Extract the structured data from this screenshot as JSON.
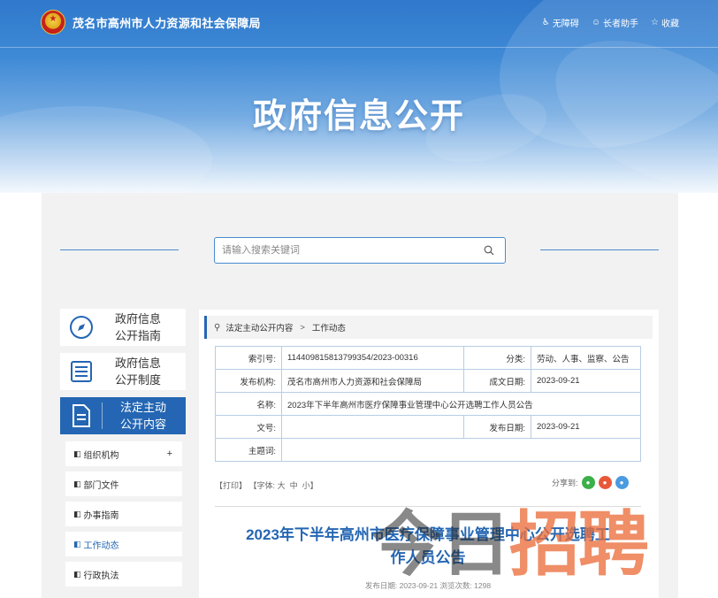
{
  "header": {
    "site_title": "茂名市高州市人力资源和社会保障局",
    "links": [
      {
        "label": "无障碍",
        "icon": "accessibility-icon"
      },
      {
        "label": "长者助手",
        "icon": "elder-assist-icon"
      },
      {
        "label": "收藏",
        "icon": "star-icon"
      }
    ],
    "banner_title": "政府信息公开"
  },
  "search": {
    "placeholder": "请输入搜索关键词",
    "value": ""
  },
  "sidebar": {
    "cards": [
      {
        "label_line1": "政府信息",
        "label_line2": "公开指南",
        "icon": "compass-icon",
        "active": false
      },
      {
        "label_line1": "政府信息",
        "label_line2": "公开制度",
        "icon": "list-icon",
        "active": false
      },
      {
        "label_line1": "法定主动",
        "label_line2": "公开内容",
        "icon": "document-icon",
        "active": true
      }
    ],
    "sub_items": [
      {
        "label": "组织机构",
        "has_plus": "+"
      },
      {
        "label": "部门文件"
      },
      {
        "label": "办事指南"
      },
      {
        "label": "工作动态",
        "current": true
      },
      {
        "label": "行政执法"
      }
    ]
  },
  "breadcrumb": {
    "level1": "法定主动公开内容",
    "separator": ">",
    "level2": "工作动态"
  },
  "meta": {
    "index_label": "索引号:",
    "index_value": "114409815813799354/2023-00316",
    "category_label": "分类:",
    "category_value": "劳动、人事、监察、公告",
    "publisher_label": "发布机构:",
    "publisher_value": "茂名市高州市人力资源和社会保障局",
    "created_label": "成文日期:",
    "created_value": "2023-09-21",
    "name_label": "名称:",
    "name_value": "2023年下半年高州市医疗保障事业管理中心公开选聘工作人员公告",
    "docno_label": "文号:",
    "docno_value": "",
    "published_label": "发布日期:",
    "published_value": "2023-09-21",
    "subject_label": "主题词:",
    "subject_value": ""
  },
  "tools": {
    "print": "【打印】",
    "font_label": "【字体:",
    "font_big": "大",
    "font_mid": "中",
    "font_small": "小",
    "font_close": "】",
    "share_label": "分享到:"
  },
  "article": {
    "title_line1": "2023年下半年高州市医疗保障事业管理中心公开选聘工",
    "title_line2": "作人员公告",
    "meta_text": "发布日期: 2023-09-21   浏览次数: 1298"
  },
  "watermark": {
    "part1": "今日",
    "part2": "招聘"
  },
  "colors": {
    "primary_blue": "#2466b3",
    "panel_gray": "#f2f2f2",
    "watermark_orange": "#eb6e3c"
  }
}
